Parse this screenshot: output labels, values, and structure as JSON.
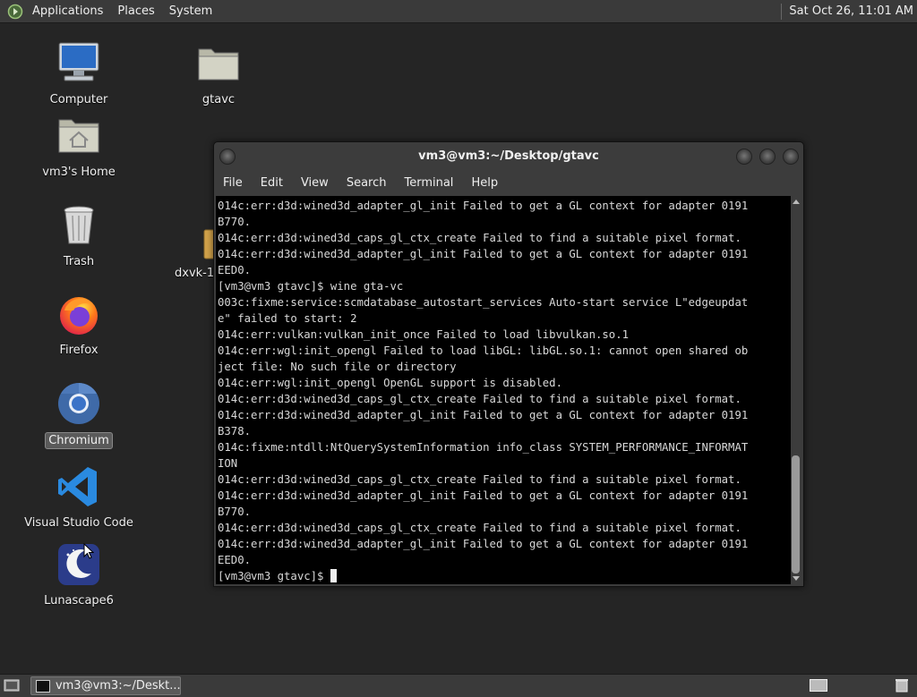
{
  "top_panel": {
    "menus": [
      "Applications",
      "Places",
      "System"
    ],
    "clock": "Sat Oct 26, 11:01 AM"
  },
  "desktop_icons": [
    {
      "label": "Computer",
      "icon": "computer-icon"
    },
    {
      "label": "gtavc",
      "icon": "folder-icon"
    },
    {
      "label": "vm3's Home",
      "icon": "home-folder-icon"
    },
    {
      "label": "Trash",
      "icon": "trash-icon"
    },
    {
      "label": "dxvk-1.",
      "icon": "archive-icon"
    },
    {
      "label": "Firefox",
      "icon": "firefox-icon"
    },
    {
      "label": "Chromium",
      "icon": "chromium-icon",
      "selected": true
    },
    {
      "label": "Visual Studio Code",
      "icon": "vscode-icon"
    },
    {
      "label": "Lunascape6",
      "icon": "lunascape-icon"
    }
  ],
  "terminal": {
    "title": "vm3@vm3:~/Desktop/gtavc",
    "menus": [
      "File",
      "Edit",
      "View",
      "Search",
      "Terminal",
      "Help"
    ],
    "lines": [
      "014c:err:d3d:wined3d_adapter_gl_init Failed to get a GL context for adapter 0191",
      "B770.",
      "014c:err:d3d:wined3d_caps_gl_ctx_create Failed to find a suitable pixel format.",
      "014c:err:d3d:wined3d_adapter_gl_init Failed to get a GL context for adapter 0191",
      "EED0.",
      "[vm3@vm3 gtavc]$ wine gta-vc",
      "003c:fixme:service:scmdatabase_autostart_services Auto-start service L\"edgeupdat",
      "e\" failed to start: 2",
      "014c:err:vulkan:vulkan_init_once Failed to load libvulkan.so.1",
      "014c:err:wgl:init_opengl Failed to load libGL: libGL.so.1: cannot open shared ob",
      "ject file: No such file or directory",
      "014c:err:wgl:init_opengl OpenGL support is disabled.",
      "014c:err:d3d:wined3d_caps_gl_ctx_create Failed to find a suitable pixel format.",
      "014c:err:d3d:wined3d_adapter_gl_init Failed to get a GL context for adapter 0191",
      "B378.",
      "014c:fixme:ntdll:NtQuerySystemInformation info_class SYSTEM_PERFORMANCE_INFORMAT",
      "ION",
      "014c:err:d3d:wined3d_caps_gl_ctx_create Failed to find a suitable pixel format.",
      "014c:err:d3d:wined3d_adapter_gl_init Failed to get a GL context for adapter 0191",
      "B770.",
      "014c:err:d3d:wined3d_caps_gl_ctx_create Failed to find a suitable pixel format.",
      "014c:err:d3d:wined3d_adapter_gl_init Failed to get a GL context for adapter 0191",
      "EED0."
    ],
    "prompt": "[vm3@vm3 gtavc]$ "
  },
  "bottom_panel": {
    "task_label": "vm3@vm3:~/Deskt..."
  }
}
